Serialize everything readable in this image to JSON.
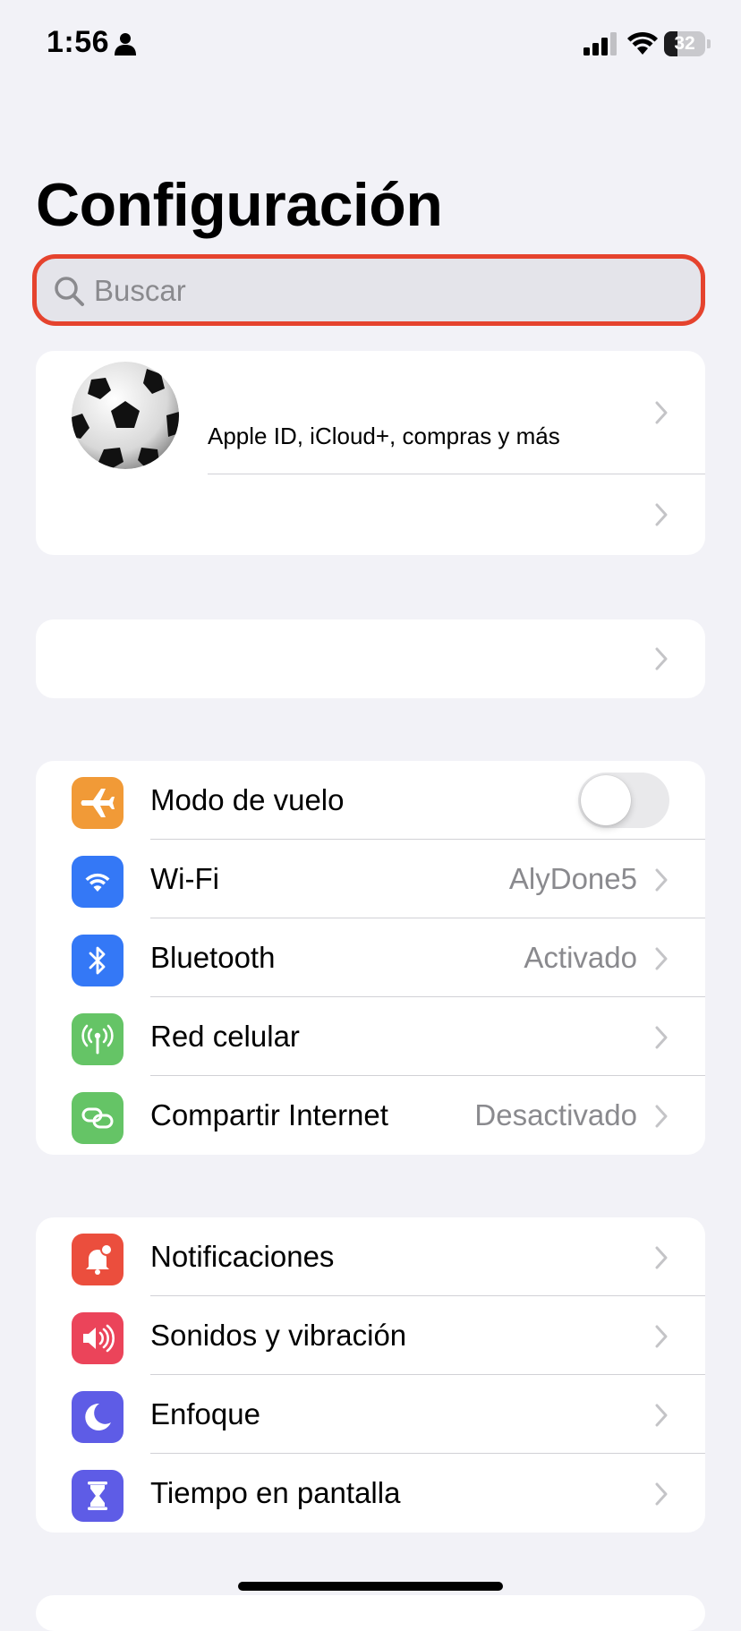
{
  "status_bar": {
    "time": "1:56",
    "battery_level": "32",
    "battery_fraction": 0.32,
    "icons": [
      "person-icon",
      "cellular-signal-icon",
      "wifi-icon",
      "battery-icon"
    ]
  },
  "header": {
    "title": "Configuración"
  },
  "search": {
    "placeholder": "Buscar",
    "highlight_color": "#e5432e"
  },
  "profile": {
    "subtitle": "Apple ID, iCloud+, compras y más",
    "avatar_icon": "soccer-ball-avatar"
  },
  "connectivity": [
    {
      "label": "Modo de vuelo",
      "value": "",
      "icon": "airplane-icon",
      "color": "#f19a37",
      "toggle": false
    },
    {
      "label": "Wi-Fi",
      "value": "AlyDone5",
      "icon": "wifi-icon",
      "color": "#3478f6"
    },
    {
      "label": "Bluetooth",
      "value": "Activado",
      "icon": "bluetooth-icon",
      "color": "#3478f6"
    },
    {
      "label": "Red celular",
      "value": "",
      "icon": "antenna-icon",
      "color": "#65c466"
    },
    {
      "label": "Compartir Internet",
      "value": "Desactivado",
      "icon": "hotspot-icon",
      "color": "#65c466"
    }
  ],
  "notifications_group": [
    {
      "label": "Notificaciones",
      "icon": "notification-bell-icon",
      "color": "#eb4e3d"
    },
    {
      "label": "Sonidos y vibración",
      "icon": "speaker-icon",
      "color": "#eb445a"
    },
    {
      "label": "Enfoque",
      "icon": "moon-icon",
      "color": "#5e5ce6"
    },
    {
      "label": "Tiempo en pantalla",
      "icon": "hourglass-icon",
      "color": "#5e5ce6"
    }
  ]
}
